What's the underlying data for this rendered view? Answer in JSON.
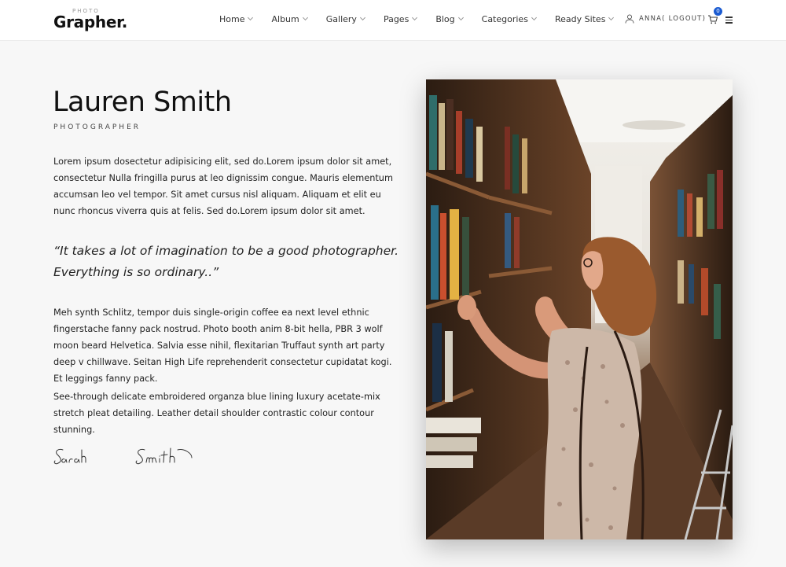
{
  "header": {
    "logo_small": "PHOTO",
    "logo_main": "Grapher.",
    "nav": [
      {
        "label": "Home"
      },
      {
        "label": "Album"
      },
      {
        "label": "Gallery"
      },
      {
        "label": "Pages"
      },
      {
        "label": "Blog"
      },
      {
        "label": "Categories"
      },
      {
        "label": "Ready Sites"
      }
    ],
    "user_label": "ANNA( LOGOUT)",
    "cart_count": "0"
  },
  "profile": {
    "name": "Lauren Smith",
    "role": "PHOTOGRAPHER",
    "paragraph1": "Lorem ipsum dosectetur adipisicing elit, sed do.Lorem ipsum dolor sit amet, consectetur Nulla fringilla purus at leo dignissim congue. Mauris elementum accumsan leo vel tempor. Sit amet cursus nisl aliquam. Aliquam et elit eu nunc rhoncus viverra quis at felis. Sed do.Lorem ipsum dolor sit amet.",
    "quote": "“It takes a lot of imagination to be a good photographer. Everything is so ordinary..”",
    "paragraph2": "Meh synth Schlitz, tempor duis single-origin coffee ea next level ethnic fingerstache fanny pack nostrud. Photo booth anim 8-bit hella, PBR 3 wolf moon beard Helvetica. Salvia esse nihil, flexitarian Truffaut synth art party deep v chillwave. Seitan High Life reprehenderit consectetur cupidatat kogi. Et leggings fanny pack.",
    "paragraph3": "See-through delicate embroidered organza blue lining luxury acetate-mix stretch pleat detailing. Leather detail shoulder contrastic colour contour stunning.",
    "signature": "Sarah Smith"
  },
  "icons": {
    "user": "user-icon",
    "cart": "cart-icon",
    "menu": "hamburger-menu-icon"
  },
  "colors": {
    "accent": "#1b5bd1",
    "background": "#f7f7f7",
    "text": "#222222"
  }
}
